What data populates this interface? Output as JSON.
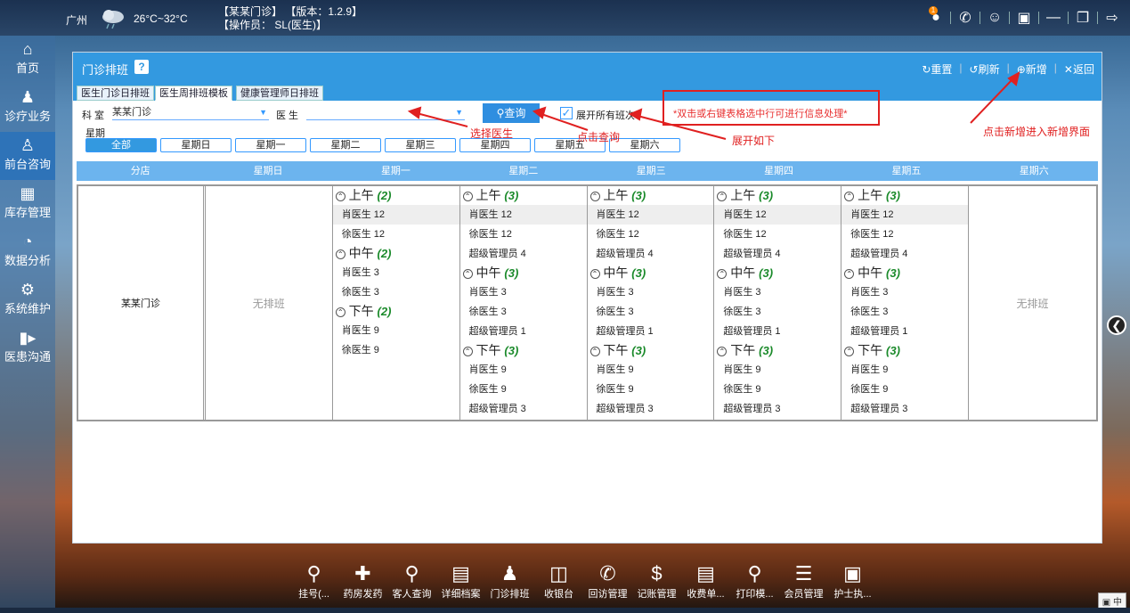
{
  "topbar": {
    "city": "广州",
    "temp": "26°C~32°C",
    "line1": "【某某门诊】  【版本：1.2.9】",
    "line2": "【操作员： SL(医生)】",
    "notify_count": "1"
  },
  "sidebar": {
    "items": [
      {
        "label": "首页",
        "icon": "home-icon"
      },
      {
        "label": "诊疗业务",
        "icon": "doctor-icon"
      },
      {
        "label": "前台咨询",
        "icon": "reception-icon"
      },
      {
        "label": "库存管理",
        "icon": "inventory-icon"
      },
      {
        "label": "数据分析",
        "icon": "chart-icon"
      },
      {
        "label": "系统维护",
        "icon": "gear-icon"
      },
      {
        "label": "医患沟通",
        "icon": "video-icon"
      }
    ]
  },
  "panel": {
    "title": "门诊排班",
    "help": "?",
    "actions": {
      "reset": "重置",
      "refresh": "刷新",
      "add": "新增",
      "back": "返回"
    },
    "tabs": [
      "医生门诊日排班",
      "医生周排班模板",
      "健康管理师日排班"
    ]
  },
  "filter": {
    "dept_label": "科 室",
    "dept_value": "某某门诊",
    "doctor_label": "医 生",
    "doctor_value": "",
    "query": "查询",
    "expand_all": "展开所有班次",
    "week_label": "星期",
    "days": [
      "全部",
      "星期日",
      "星期一",
      "星期二",
      "星期三",
      "星期四",
      "星期五",
      "星期六"
    ],
    "note": "*双击或右键表格选中行可进行信息处理*"
  },
  "annotations": {
    "select_doctor": "选择医生",
    "click_query": "点击查询",
    "expand_below": "展开如下",
    "add_hint": "点击新增进入新增界面"
  },
  "table": {
    "headers": [
      "分店",
      "星期日",
      "星期一",
      "星期二",
      "星期三",
      "星期四",
      "星期五",
      "星期六"
    ],
    "branch": "某某门诊",
    "no_schedule": "无排班",
    "mon": {
      "am": "上午",
      "am_count": "(2)",
      "am_docs": [
        "肖医生 12",
        "徐医生 12"
      ],
      "noon": "中午",
      "noon_count": "(2)",
      "noon_docs": [
        "肖医生 3",
        "徐医生 3"
      ],
      "pm": "下午",
      "pm_count": "(2)",
      "pm_docs": [
        "肖医生 9",
        "徐医生 9"
      ]
    },
    "weekday": {
      "am": "上午",
      "am_count": "(3)",
      "am_docs": [
        "肖医生 12",
        "徐医生 12",
        "超级管理员 4"
      ],
      "noon": "中午",
      "noon_count": "(3)",
      "noon_docs": [
        "肖医生 3",
        "徐医生 3",
        "超级管理员 1"
      ],
      "pm": "下午",
      "pm_count": "(3)",
      "pm_docs": [
        "肖医生 9",
        "徐医生 9",
        "超级管理员 3"
      ]
    }
  },
  "dock": [
    "挂号(...",
    "药房发药",
    "客人查询",
    "详细档案",
    "门诊排班",
    "收银台",
    "回访管理",
    "记账管理",
    "收费单...",
    "打印模...",
    "会员管理",
    "护士执..."
  ],
  "tray": "中"
}
